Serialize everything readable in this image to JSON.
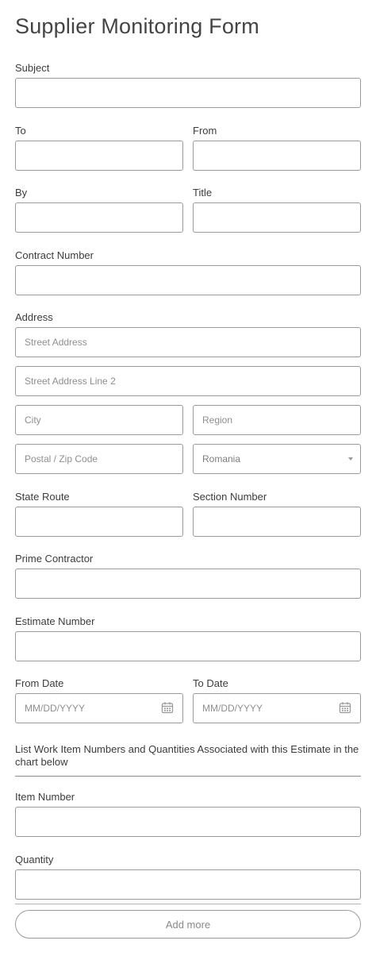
{
  "form": {
    "title": "Supplier Monitoring Form",
    "subject_label": "Subject",
    "to_label": "To",
    "from_label": "From",
    "by_label": "By",
    "title_label": "Title",
    "contract_number_label": "Contract Number",
    "address_label": "Address",
    "street_placeholder": "Street Address",
    "street2_placeholder": "Street Address Line 2",
    "city_placeholder": "City",
    "region_placeholder": "Region",
    "zip_placeholder": "Postal / Zip Code",
    "country_value": "Romania",
    "state_route_label": "State Route",
    "section_number_label": "Section Number",
    "prime_contractor_label": "Prime Contractor",
    "estimate_number_label": "Estimate Number",
    "from_date_label": "From Date",
    "to_date_label": "To Date",
    "date_placeholder": "MM/DD/YYYY",
    "work_items_note": "List Work Item Numbers and Quantities Associated with this Estimate in the chart below",
    "item_number_label": "Item Number",
    "quantity_label": "Quantity",
    "add_more_label": "Add more"
  },
  "icons": {
    "date_picker": "calendar-icon",
    "dropdown": "chevron-down-icon"
  }
}
